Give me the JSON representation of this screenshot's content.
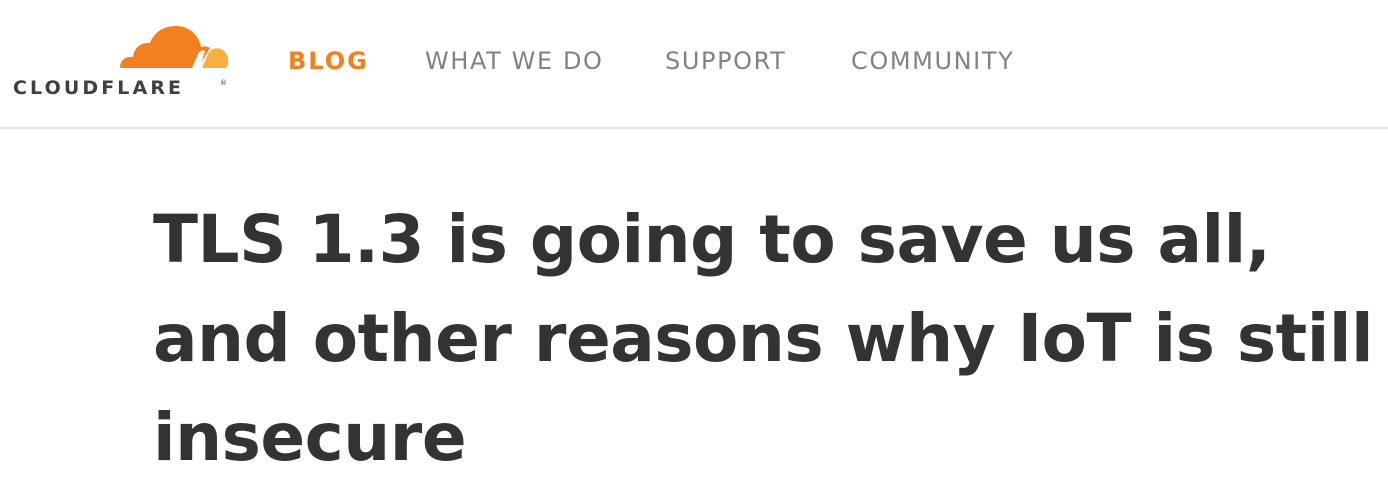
{
  "brand": {
    "name": "CLOUDFLARE",
    "registered_mark": "®",
    "icon": "cloud-logo-icon",
    "colors": {
      "orange": "#f38020",
      "light_orange": "#faae40",
      "text_dark": "#404041"
    }
  },
  "nav": {
    "items": [
      {
        "label": "BLOG",
        "active": true
      },
      {
        "label": "WHAT WE DO",
        "active": false
      },
      {
        "label": "SUPPORT",
        "active": false
      },
      {
        "label": "COMMUNITY",
        "active": false
      }
    ],
    "colors": {
      "active": "#f38020",
      "inactive": "#808285"
    }
  },
  "article": {
    "title": "TLS 1.3 is going to save us all, and other reasons why IoT is still insecure",
    "title_color": "#333333"
  }
}
